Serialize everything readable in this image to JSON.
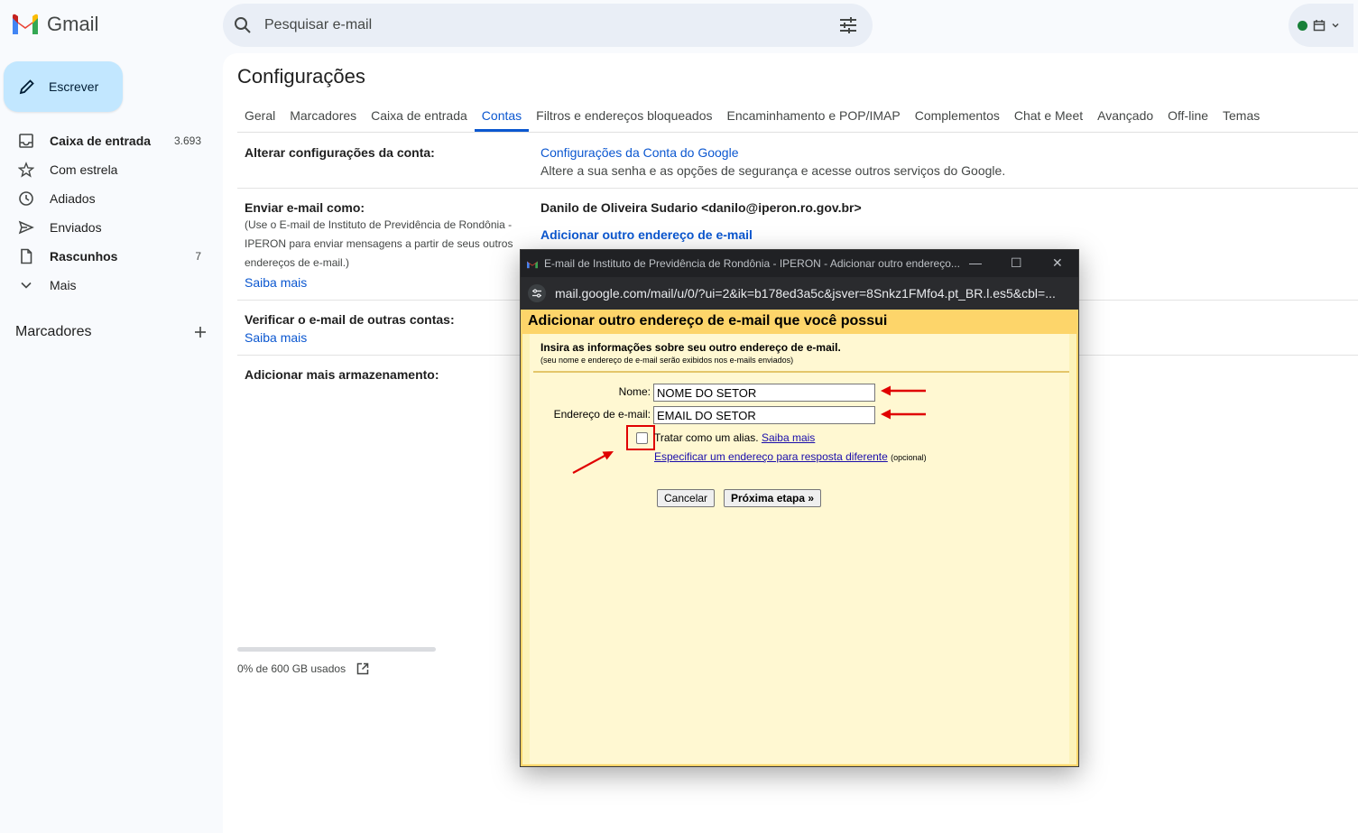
{
  "app": {
    "name": "Gmail"
  },
  "search": {
    "placeholder": "Pesquisar e-mail"
  },
  "sidebar": {
    "compose": "Escrever",
    "items": [
      {
        "label": "Caixa de entrada",
        "count": "3.693",
        "icon": "inbox-icon"
      },
      {
        "label": "Com estrela",
        "count": "",
        "icon": "star-icon"
      },
      {
        "label": "Adiados",
        "count": "",
        "icon": "clock-icon"
      },
      {
        "label": "Enviados",
        "count": "",
        "icon": "send-icon"
      },
      {
        "label": "Rascunhos",
        "count": "7",
        "icon": "draft-icon"
      },
      {
        "label": "Mais",
        "count": "",
        "icon": "chevron-down-icon"
      }
    ],
    "labels_title": "Marcadores"
  },
  "settings": {
    "title": "Configurações",
    "tabs": [
      "Geral",
      "Marcadores",
      "Caixa de entrada",
      "Contas",
      "Filtros e endereços bloqueados",
      "Encaminhamento e POP/IMAP",
      "Complementos",
      "Chat e Meet",
      "Avançado",
      "Off-line",
      "Temas"
    ],
    "active_tab": "Contas",
    "account": {
      "label": "Alterar configurações da conta:",
      "link": "Configurações da Conta do Google",
      "desc": "Altere a sua senha e as opções de segurança e acesse outros serviços do Google."
    },
    "send_as": {
      "label": "Enviar e-mail como:",
      "desc": "(Use o E-mail de Instituto de Previdência de Rondônia - IPERON para enviar mensagens a partir de seus outros endereços de e-mail.)",
      "learn_more": "Saiba mais",
      "address": "Danilo de Oliveira Sudario <danilo@iperon.ro.gov.br>",
      "add_link": "Adicionar outro endereço de e-mail"
    },
    "check_mail": {
      "label": "Verificar o e-mail de outras contas:",
      "learn_more": "Saiba mais"
    },
    "storage": {
      "label": "Adicionar mais armazenamento:",
      "usage": "0% de 600 GB usados",
      "used_fraction": 0
    }
  },
  "popup": {
    "window_title": "E-mail de Instituto de Previdência de Rondônia - IPERON - Adicionar outro endereço...",
    "url": "mail.google.com/mail/u/0/?ui=2&ik=b178ed3a5c&jsver=8Snkz1FMfo4.pt_BR.l.es5&cbl=...",
    "heading": "Adicionar outro endereço de e-mail que você possui",
    "instructions": "Insira as informações sobre seu outro endereço de e-mail.",
    "note": "(seu nome e endereço de e-mail serão exibidos nos e-mails enviados)",
    "name_label": "Nome:",
    "name_value": "NOME DO SETOR",
    "email_label": "Endereço de e-mail:",
    "email_value": "EMAIL DO SETOR",
    "alias_label": "Tratar como um alias.",
    "alias_link": "Saiba mais",
    "alias_checked": false,
    "reply_link": "Especificar um endereço para resposta diferente",
    "optional": "(opcional)",
    "cancel": "Cancelar",
    "next": "Próxima etapa »"
  },
  "colors": {
    "accent": "#0b57d0",
    "annotation": "#e00000",
    "popup_bg": "#fff8d2",
    "popup_header": "#fdd56a"
  }
}
